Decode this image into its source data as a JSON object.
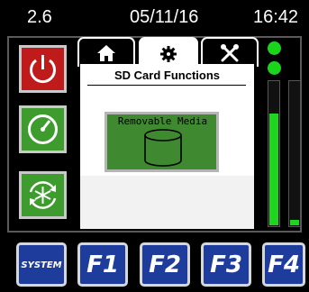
{
  "status_bar": {
    "version": "2.6",
    "date": "05/11/16",
    "time": "16:42"
  },
  "side_buttons": [
    {
      "icon": "power-icon",
      "color": "#c01b1b"
    },
    {
      "icon": "gauge-icon",
      "color": "#3e9b2e"
    },
    {
      "icon": "snowflake-refresh-icon",
      "color": "#3e9b2e"
    }
  ],
  "tabs": [
    {
      "icon": "home-icon",
      "active": false
    },
    {
      "icon": "gear-icon",
      "active": true
    },
    {
      "icon": "tools-icon",
      "active": false
    }
  ],
  "panel": {
    "title": "SD Card Functions",
    "media_button": {
      "label": "Removable Media",
      "icon": "database-icon"
    }
  },
  "meters": {
    "leds": [
      {
        "state": "on",
        "color": "#19d61b"
      },
      {
        "state": "on",
        "color": "#19d61b"
      }
    ],
    "bars": [
      {
        "level": 0.78
      },
      {
        "level": 0.05
      }
    ]
  },
  "function_keys": [
    {
      "label": "SYSTEM"
    },
    {
      "label": "F1"
    },
    {
      "label": "F2"
    },
    {
      "label": "F3"
    },
    {
      "label": "F4"
    }
  ]
}
